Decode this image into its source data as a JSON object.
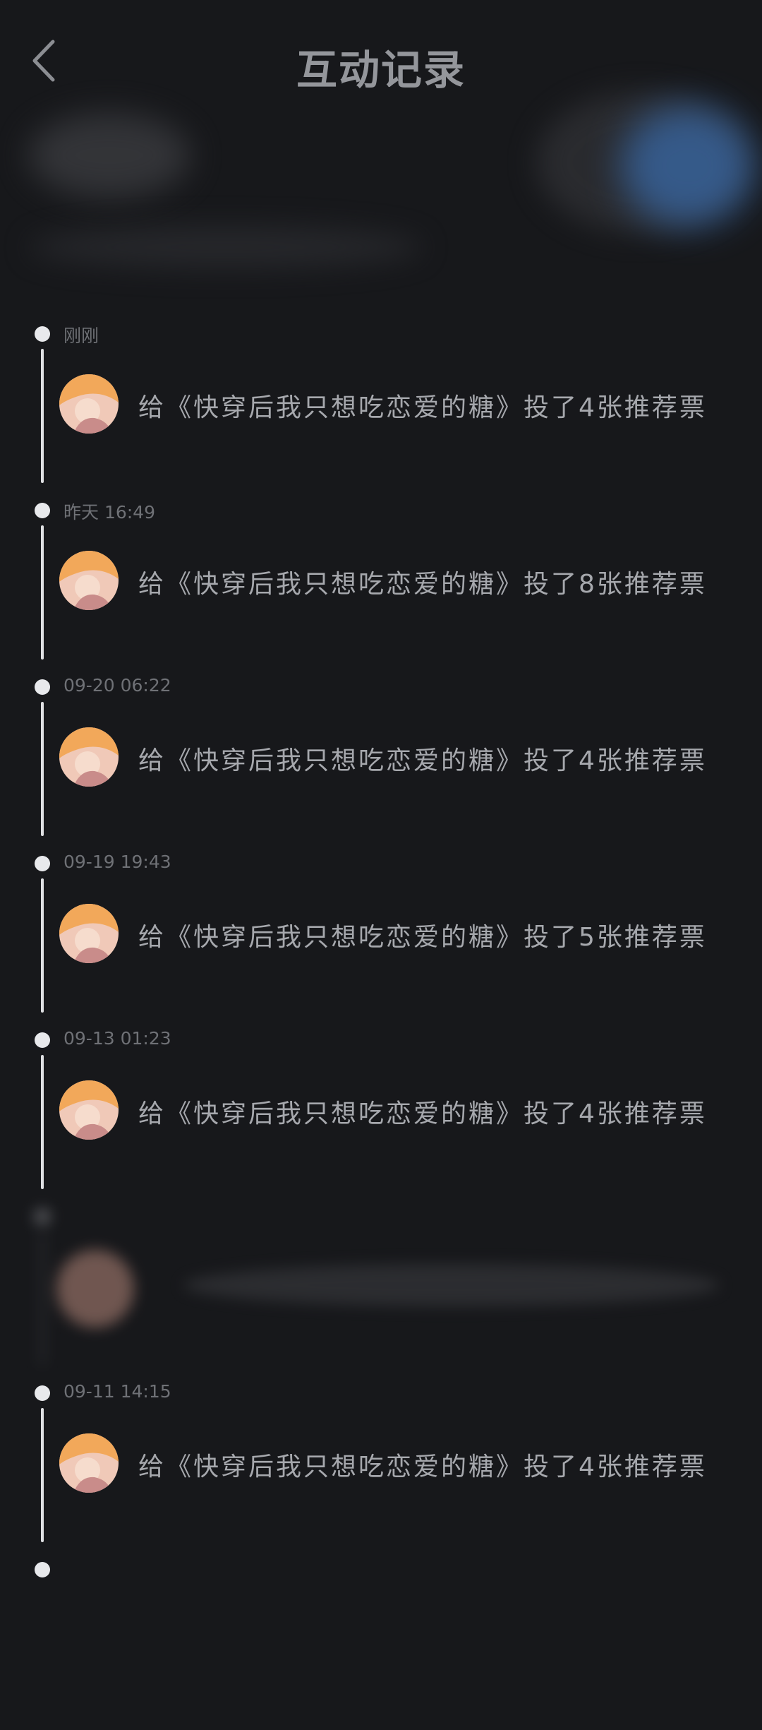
{
  "header": {
    "title": "互动记录"
  },
  "entries": [
    {
      "time": "刚刚",
      "message": "给《快穿后我只想吃恋爱的糖》投了4张推荐票"
    },
    {
      "time": "昨天 16:49",
      "message": "给《快穿后我只想吃恋爱的糖》投了8张推荐票"
    },
    {
      "time": "09-20 06:22",
      "message": "给《快穿后我只想吃恋爱的糖》投了4张推荐票"
    },
    {
      "time": "09-19 19:43",
      "message": "给《快穿后我只想吃恋爱的糖》投了5张推荐票"
    },
    {
      "time": "09-13 01:23",
      "message": "给《快穿后我只想吃恋爱的糖》投了4张推荐票"
    },
    {
      "time": "09-11 14:15",
      "message": "给《快穿后我只想吃恋爱的糖》投了4张推荐票"
    }
  ],
  "colors": {
    "background": "#17181b",
    "text": "#a6a8ad",
    "timestamp": "#6f7176",
    "timeline": "#dfe0e3",
    "blur_accent": "#3a6aa8"
  }
}
